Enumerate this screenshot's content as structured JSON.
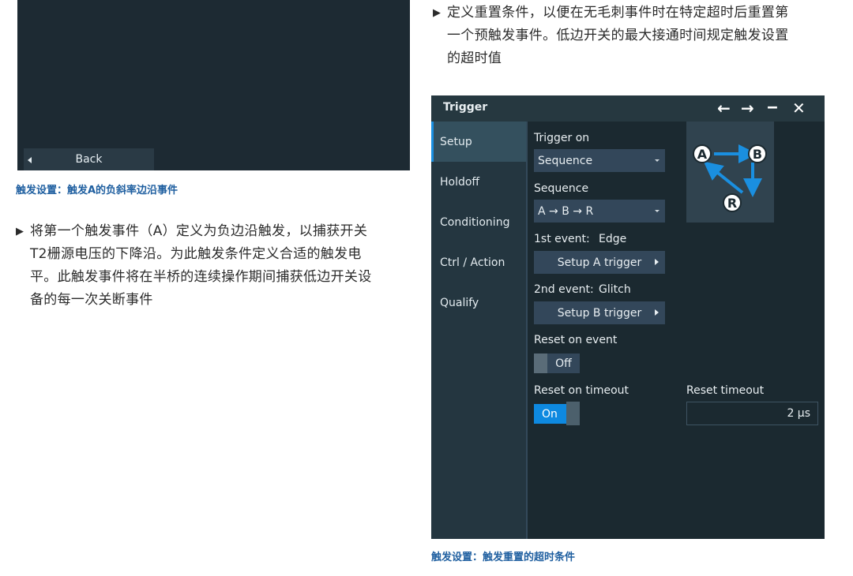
{
  "left": {
    "back_label": "Back",
    "caption": "触发设置：触发A的负斜率边沿事件",
    "para_lines": [
      "将第一个触发事件（A）定义为负边沿触发，以捕获开关",
      "T2栅源电压的下降沿。为此触发条件定义合适的触发电",
      "平。此触发事件将在半桥的连续操作期间捕获低边开关设",
      "备的每一次关断事件"
    ]
  },
  "right": {
    "para_lines": [
      "定义重置条件，以便在无毛刺事件时在特定超时后重置第",
      "一个预触发事件。低边开关的最大接通时间规定触发设置",
      "的超时值"
    ],
    "caption": "触发设置：触发重置的超时条件"
  },
  "bullet": "▶",
  "dialog": {
    "title": "Trigger",
    "icons": [
      "arrow-left-icon",
      "arrow-right-icon",
      "minimize-icon",
      "close-icon"
    ],
    "sidebar": [
      {
        "label": "Setup",
        "active": true
      },
      {
        "label": "Holdoff",
        "active": false
      },
      {
        "label": "Conditioning",
        "active": false
      },
      {
        "label": "Ctrl / Action",
        "active": false
      },
      {
        "label": "Qualify",
        "active": false
      }
    ],
    "trigger_on_label": "Trigger on",
    "trigger_on_value": "Sequence",
    "sequence_label": "Sequence",
    "sequence_value": "A → B → R",
    "first_event_label": "1st event:",
    "first_event_value": "Edge",
    "setup_a_label": "Setup A trigger",
    "second_event_label": "2nd event:",
    "second_event_value": "Glitch",
    "setup_b_label": "Setup B trigger",
    "reset_on_event_label": "Reset on event",
    "reset_on_event_value": "Off",
    "reset_on_timeout_label": "Reset on timeout",
    "reset_on_timeout_value": "On",
    "reset_timeout_label": "Reset timeout",
    "reset_timeout_value": "2 µs",
    "diagram": {
      "node_a": "A",
      "node_b": "B",
      "node_r": "R"
    },
    "colors": {
      "accent": "#0e89e0",
      "background": "#1b2930",
      "panel": "#33475a"
    }
  }
}
